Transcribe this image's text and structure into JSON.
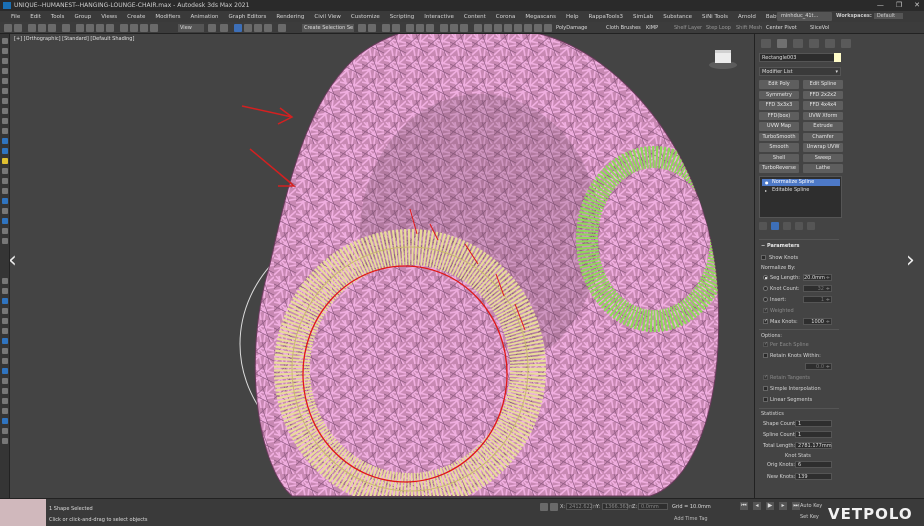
{
  "window": {
    "title": "UNIQUE--HUMANEST--HANGING-LOUNGE-CHAIR.max - Autodesk 3ds Max 2021",
    "controls": [
      "—",
      "❐",
      "✕"
    ]
  },
  "menu": {
    "items": [
      "File",
      "Edit",
      "Tools",
      "Group",
      "Views",
      "Create",
      "Modifiers",
      "Animation",
      "Graph Editors",
      "Rendering",
      "Civil View",
      "Customize",
      "Scripting",
      "Interactive",
      "Content",
      "Corona",
      "Megascans",
      "Help",
      "RappaTools3",
      "SimLab",
      "Substance",
      "SiNi Tools",
      "Arnold",
      "Babylon"
    ],
    "user": "minhduc_41t...",
    "workspace_label": "Workspaces:",
    "workspace_value": "Default"
  },
  "toolbar": {
    "view_dropdown": "View",
    "selection_set": "Create Selection Se",
    "plugins": [
      "PolyDamage",
      "Cloth Brushes",
      "KIMP",
      "Shelf Layer",
      "Step Loop",
      "Shift Mesh",
      "Center Pivot",
      "SliceVol"
    ]
  },
  "viewport": {
    "label": "[+] [Orthographic] [Standard] [Default Shading]",
    "nav_prev": "‹",
    "nav_next": "›"
  },
  "panel": {
    "object_name": "Rectangle003",
    "object_color": "#fffcc8",
    "modifier_list": "Modifier List",
    "modifier_buttons": [
      "Edit Poly",
      "Edit Spline",
      "Symmetry",
      "FFD 2x2x2",
      "FFD 3x3x3",
      "FFD 4x4x4",
      "FFD(box)",
      "UVW Xform",
      "UVW Map",
      "Extrude",
      "TurboSmooth",
      "Chamfer",
      "Smooth",
      "Unwrap UVW",
      "Shell",
      "Sweep",
      "TurboReverse",
      "Lathe"
    ],
    "stack": [
      {
        "label": "Normalize Spline",
        "selected": true
      },
      {
        "label": "Editable Spline",
        "selected": false
      }
    ],
    "parameters": {
      "title": "Parameters",
      "show_knots": "Show Knots",
      "normalize_by": "Normalize By:",
      "seg_length_label": "Seg Length:",
      "seg_length_value": "20.0mm",
      "knot_count_label": "Knot Count:",
      "knot_count_value": "32",
      "insert_label": "Insert:",
      "insert_value": "1",
      "weighted": "Weighted",
      "max_knots_label": "Max Knots:",
      "max_knots_value": "1000",
      "options": "Options:",
      "per_each_spline": "Per Each Spline",
      "retain_knots_within": "Retain Knots Within:",
      "retain_value": "0.0",
      "retain_tangents": "Retain Tangents",
      "simple_interpolation": "Simple Interpolation",
      "linear_segments": "Linear Segments"
    },
    "statistics": {
      "title": "Statistics",
      "shape_count_label": "Shape Count:",
      "shape_count_value": "1",
      "spline_count_label": "Spline Count:",
      "spline_count_value": "1",
      "total_length_label": "Total Length:",
      "total_length_value": "2781.177mm",
      "knot_stats": "Knot Stats",
      "orig_knots_label": "Orig Knots:",
      "orig_knots_value": "6",
      "new_knots_label": "New Knots:",
      "new_knots_value": "139"
    }
  },
  "status": {
    "selected": "1 Shape Selected",
    "prompt": "Click or click-and-drag to select objects",
    "x_label": "X:",
    "x_value": "2412.622m",
    "y_label": "Y:",
    "y_value": "1366.363m",
    "z_label": "Z:",
    "z_value": "0.0mm",
    "grid": "Grid = 10.0mm",
    "add_time_tag": "Add Time Tag",
    "auto_key": "Auto Key",
    "set_key": "Set Key",
    "watermark": "VETPOLO"
  },
  "colors": {
    "pink_rope": "#e596c8",
    "green_ring": "#8fd85a",
    "yellow_ring": "#e8dc9a",
    "red_spline": "#e01818",
    "selection_blue": "#4d79c7"
  }
}
